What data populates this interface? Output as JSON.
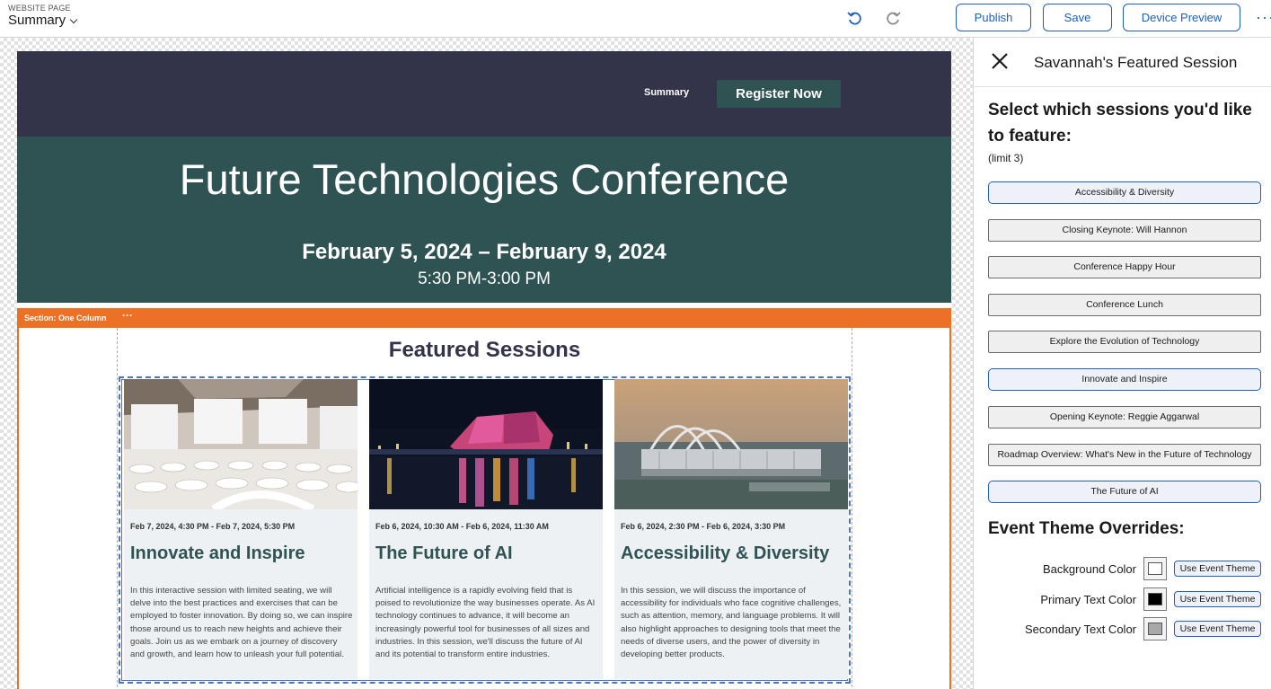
{
  "topbar": {
    "page_caption": "WEBSITE PAGE",
    "page_name": "Summary",
    "publish_label": "Publish",
    "save_label": "Save",
    "device_preview_label": "Device Preview",
    "more_label": "···"
  },
  "site": {
    "nav_link": "Summary",
    "register_label": "Register Now",
    "hero_title": "Future Technologies Conference",
    "hero_dates": "February 5, 2024 – February 9, 2024",
    "hero_time": "5:30 PM-3:00 PM",
    "section_label": "Section: One Column",
    "section_menu": "···",
    "featured_title": "Featured Sessions",
    "cards": [
      {
        "date": "Feb 7, 2024, 4:30 PM - Feb 7, 2024, 5:30 PM",
        "title": "Innovate and Inspire",
        "description": "In this interactive session with limited seating, we will delve into the best practices and exercises that can be employed to foster innovation. By doing so, we can inspire those around us to reach new heights and achieve their goals. Join us as we embark on a journey of discovery and growth, and learn how to unleash your full potential."
      },
      {
        "date": "Feb 6, 2024, 10:30 AM - Feb 6, 2024, 11:30 AM",
        "title": "The Future of AI",
        "description": "Artificial intelligence is a rapidly evolving field that is poised to revolutionize the way businesses operate. As AI technology continues to advance, it will become an increasingly powerful tool for businesses of all sizes and industries. In this session, we'll discuss the future of AI and its potential to transform entire industries."
      },
      {
        "date": "Feb 6, 2024, 2:30 PM - Feb 6, 2024, 3:30 PM",
        "title": "Accessibility & Diversity",
        "description": "In this session, we will discuss the importance of accessibility for individuals who face cognitive challenges, such as attention, memory, and language problems. It will also highlight approaches to designing tools that meet the needs of diverse users, and the power of diversity in developing better products."
      }
    ]
  },
  "panel": {
    "title": "Savannah's Featured Session",
    "heading": "Select which sessions you'd like to feature:",
    "limit": "(limit 3)",
    "sessions": [
      {
        "label": "Accessibility & Diversity",
        "selected": true
      },
      {
        "label": "Closing Keynote: Will Hannon",
        "selected": false
      },
      {
        "label": "Conference Happy Hour",
        "selected": false
      },
      {
        "label": "Conference Lunch",
        "selected": false
      },
      {
        "label": "Explore the Evolution of Technology",
        "selected": false
      },
      {
        "label": "Innovate and Inspire",
        "selected": true
      },
      {
        "label": "Opening Keynote: Reggie Aggarwal",
        "selected": false
      },
      {
        "label": "Roadmap Overview: What's New in the Future of Technology",
        "selected": false
      },
      {
        "label": "The Future of AI",
        "selected": true
      }
    ],
    "theme_heading": "Event Theme Overrides:",
    "theme_rows": [
      {
        "label": "Background Color",
        "color": "#ffffff",
        "button": "Use Event Theme"
      },
      {
        "label": "Primary Text Color",
        "color": "#000000",
        "button": "Use Event Theme"
      },
      {
        "label": "Secondary Text Color",
        "color": "#a9a9a9",
        "button": "Use Event Theme"
      }
    ]
  },
  "colors": {
    "accent": "#1f5fbf",
    "nav_bg": "#33334a",
    "hero_bg": "#2f5353",
    "section_orange": "#ec7125"
  }
}
